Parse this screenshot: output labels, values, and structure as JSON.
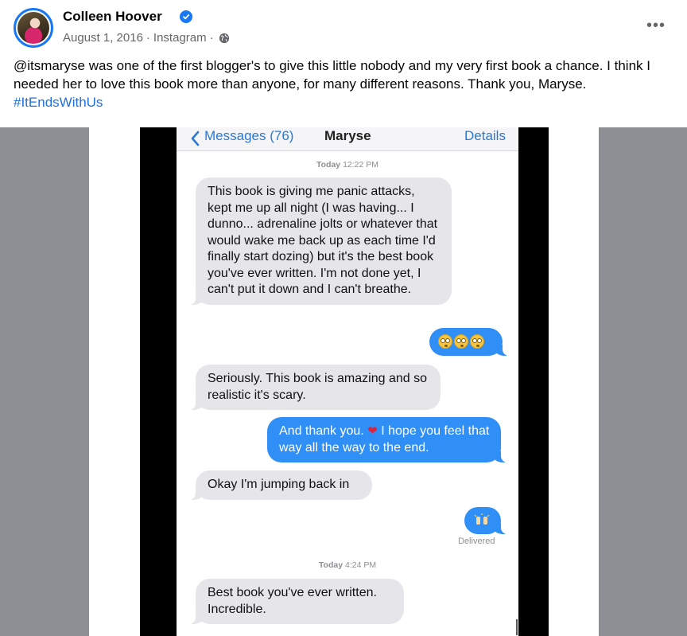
{
  "post": {
    "author": "Colleen Hoover",
    "date": "August 1, 2016",
    "source": "Instagram",
    "separator": "·",
    "text_main": "@itsmaryse was one of the first blogger's to give this little nobody and my very first book a chance. I think I needed her to love this book more than anyone, for many different reasons. Thank you, Maryse. ",
    "hashtag": "#ItEndsWithUs",
    "more_icon": "more-options-icon",
    "verified_icon": "verified-badge-icon",
    "privacy_icon": "globe-icon"
  },
  "screenshot": {
    "nav": {
      "back_label": "Messages (76)",
      "title": "Maryse",
      "details": "Details"
    },
    "timestamp1_day": "Today",
    "timestamp1_time": "12:22 PM",
    "timestamp2_day": "Today",
    "timestamp2_time": "4:24 PM",
    "messages": {
      "m1": "This book is giving me panic attacks, kept me up all night (I was having... I dunno... adrenaline jolts or whatever that would wake me back up as each time I'd finally start dozing) but it's the best book you've ever written. I'm not done yet, I can't put it down and I can't breathe.",
      "m3": "Seriously. This book is amazing and so realistic it's scary.",
      "m4a": "And thank you.",
      "m4b": "I hope you feel that way all the way to the end.",
      "m5": "Okay I'm jumping back in",
      "m7": "Best book you've ever written. Incredible."
    },
    "emoji_reply": "flushed-face-emoji x3",
    "hands_reply": "raised-hands-emoji",
    "heart": "❤",
    "delivered": "Delivered"
  }
}
